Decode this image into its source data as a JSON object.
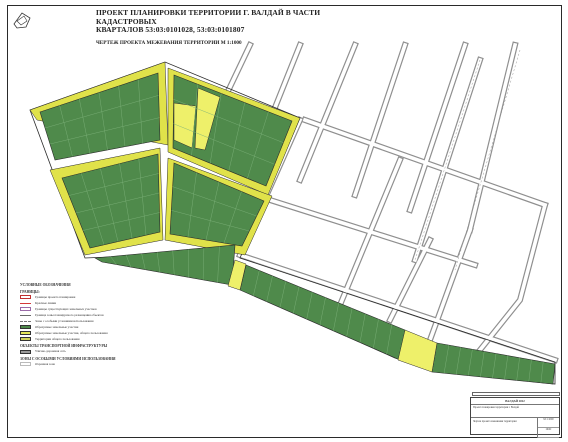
{
  "header": {
    "title_line1": "ПРОЕКТ ПЛАНИРОВКИ ТЕРРИТОРИИ Г. ВАЛДАЙ В ЧАСТИ КАДАСТРОВЫХ",
    "title_line2": "КВАРТАЛОВ 53:03:0101028, 53:03:0101807",
    "subtitle": "ЧЕРТЕЖ ПРОЕКТА МЕЖЕВАНИЯ ТЕРРИТОРИИ   М 1:1000"
  },
  "legend": {
    "title": "УСЛОВНЫЕ ОБОЗНАЧЕНИЯ",
    "group1": "ГРАНИЦЫ:",
    "items": [
      {
        "label": "Границы проекта планировки",
        "color": "#c03030",
        "style": "outline"
      },
      {
        "label": "Красные линии",
        "color": "#d43a3a",
        "style": "line"
      },
      {
        "label": "Границы существующих земельных участков",
        "color": "#9a6aa8",
        "style": "outline"
      },
      {
        "label": "Граница зоны планируемого размещения объектов",
        "color": "#6a6a6a",
        "style": "line"
      },
      {
        "label": "Зоны с особыми условиями использования",
        "color": "#7a7a7a",
        "style": "dash"
      },
      {
        "label": "Образуемые земельные участки",
        "color": "#4f8a4b",
        "style": "fill"
      },
      {
        "label": "Образуемые земельные участки, общего пользования",
        "color": "#e4e85a",
        "style": "fill"
      },
      {
        "label": "Территории общего пользования",
        "color": "#cfd35a",
        "style": "fill"
      }
    ],
    "group2": "ОБЪЕКТЫ ТРАНСПОРТНОЙ ИНФРАСТРУКТУРЫ",
    "items2": [
      {
        "label": "Улично-дорожная сеть",
        "color": "#9a9a9a",
        "style": "fill"
      }
    ],
    "group3": "ЗОНЫ С ОСОБЫМИ УСЛОВИЯМИ ИСПОЛЬЗОВАНИЯ",
    "items3": [
      {
        "label": "Охранная зона",
        "color": "#bbbbbb",
        "style": "outline"
      }
    ]
  },
  "stamp": {
    "header": "ВАЛДАЙ 2022",
    "org": "Проект планировки территории г. Валдай",
    "sheet_title": "Чертеж проекта межевания территории",
    "scale": "М 1:1000",
    "company": "ООО"
  },
  "colors": {
    "plot": "#4f8a4b",
    "plot_line": "#6fa46b",
    "border_yellow": "#e0e24a",
    "public_yellow": "#eef06a",
    "road": "#8f8f8f",
    "road_inner": "#ffffff",
    "boundary": "#2b2b2b"
  }
}
